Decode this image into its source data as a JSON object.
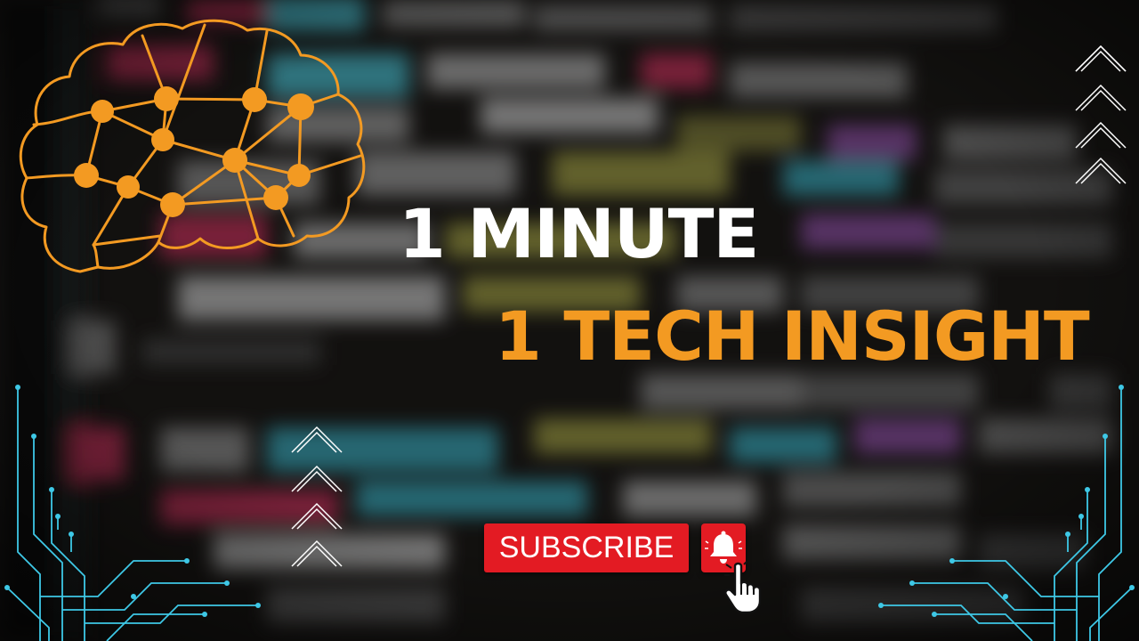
{
  "headline": {
    "line1": "1 MINUTE",
    "line2": "1 TECH INSIGHT"
  },
  "subscribe": {
    "label": "SUBSCRIBE",
    "bell_icon": "bell-icon",
    "cursor_icon": "hand-pointer-icon"
  },
  "decorations": {
    "brain_logo_icon": "brain-network-icon",
    "chevron_icon": "chevron-up-icon",
    "circuit_icon": "circuit-lines-icon"
  },
  "colors": {
    "accent_orange": "#f39a22",
    "headline_white": "#ffffff",
    "subscribe_red": "#e31b23",
    "circuit_cyan": "#3ec8e6"
  }
}
